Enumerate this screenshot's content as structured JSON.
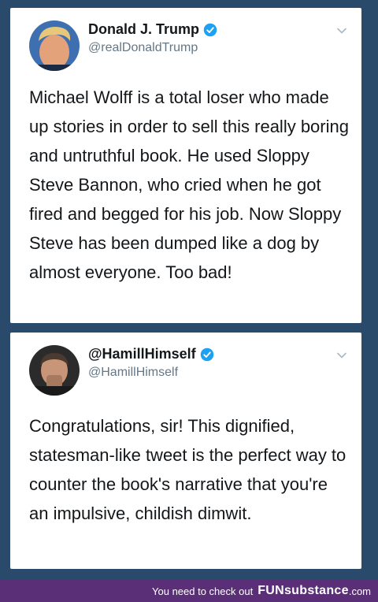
{
  "tweets": [
    {
      "display_name": "Donald J. Trump",
      "handle": "@realDonaldTrump",
      "verified": true,
      "avatar_icon": "profile-photo",
      "text": "Michael Wolff is a total loser who made up stories in order to sell this really boring and untruthful book. He used Sloppy Steve Bannon, who cried when he got fired and begged for his job. Now Sloppy Steve has been dumped like a dog by almost everyone. Too bad!"
    },
    {
      "display_name": "@HamillHimself",
      "handle": "@HamillHimself",
      "verified": true,
      "avatar_icon": "profile-photo",
      "text": "Congratulations, sir! This dignified, statesman-like tweet is the perfect way to counter the book's narrative that you're an impulsive, childish dimwit."
    }
  ],
  "footer": {
    "text": "You need to check out",
    "brand": "FUNsubstance",
    "domain": ".com"
  },
  "colors": {
    "background": "#2a4a6b",
    "footer": "#5a2f78",
    "verified": "#1da1f2",
    "handle": "#657786"
  }
}
